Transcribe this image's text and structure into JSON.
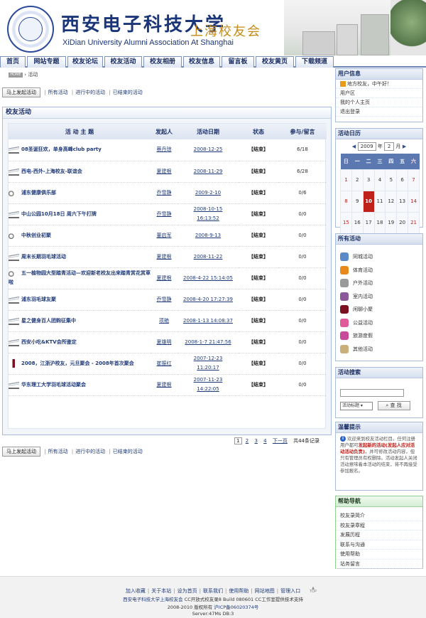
{
  "header": {
    "title": "西安电子科技大学",
    "subtitle": "上海校友会",
    "title_en": "XiDian University Alumni Association At Shanghai"
  },
  "nav": [
    {
      "label": "首页"
    },
    {
      "label": "网站专题"
    },
    {
      "label": "校友论坛"
    },
    {
      "label": "校友活动"
    },
    {
      "label": "校友相册"
    },
    {
      "label": "校友信息"
    },
    {
      "label": "留言板"
    },
    {
      "label": "校友黄页"
    },
    {
      "label": "下载频道"
    }
  ],
  "breadcrumb": {
    "home": "HOME",
    "current": "活动"
  },
  "actionbar": {
    "start": "马上发起活动",
    "all": "所有活动",
    "ongoing": "进行中的活动",
    "ended": "已结束的活动"
  },
  "main": {
    "title": "校友活动",
    "columns": [
      "活 动 主 题",
      "发起人",
      "活动日期",
      "状态",
      "参与/留言"
    ],
    "rows": [
      {
        "icon": "plane",
        "title": "08圣诞狂欢，单身高峰club party",
        "initiator": "蔡丹琼",
        "date": "2008-12-25",
        "time": "",
        "status": "【结束】",
        "count": "6/18"
      },
      {
        "icon": "plane",
        "title": "西电-西外-上海校友-联谊会",
        "initiator": "夏建根",
        "date": "2008-11-29",
        "time": "",
        "status": "【结束】",
        "count": "6/28"
      },
      {
        "icon": "bike",
        "title": "浦东健康俱乐部",
        "initiator": "乔雪静",
        "date": "2009-2-10",
        "time": "",
        "status": "【结束】",
        "count": "0/6"
      },
      {
        "icon": "plane",
        "title": "中山公园10月18日 周六下午打牌",
        "initiator": "乔雪静",
        "date": "2008-10-15",
        "time": "16:13:52",
        "status": "【结束】",
        "count": "0/0"
      },
      {
        "icon": "bike",
        "title": "中秋创业初聚",
        "initiator": "董启军",
        "date": "2008-9-13",
        "time": "",
        "status": "【结束】",
        "count": "0/0"
      },
      {
        "icon": "plane",
        "title": "周末长期羽毛球活动",
        "initiator": "夏建根",
        "date": "2008-11-22",
        "time": "",
        "status": "【结束】",
        "count": "0/0"
      },
      {
        "icon": "bike",
        "title": "五一植物园大型踏青活动—欢迎新老校友出来踏青赏花赏草啦",
        "initiator": "夏建根",
        "date": "2008-4-22 15:14:05",
        "time": "",
        "status": "【结束】",
        "count": "0/0"
      },
      {
        "icon": "plane",
        "title": "浦东羽毛球友聚",
        "initiator": "乔雪静",
        "date": "2008-4-20 17:27:39",
        "time": "",
        "status": "【结束】",
        "count": "0/0"
      },
      {
        "icon": "plane",
        "title": "星之健身百人团购征集中",
        "initiator": "项艳",
        "date": "2008-1-13 14:08:37",
        "time": "",
        "status": "【结束】",
        "count": "0/0"
      },
      {
        "icon": "plane",
        "title": "西安小吃&KTV会所鉴定",
        "initiator": "夏雄明",
        "date": "2008-1-7 21:47:56",
        "time": "",
        "status": "【结束】",
        "count": "0/0"
      },
      {
        "icon": "wine",
        "title": "2008，江浙沪校友，元旦聚会 - 2008年首次聚会",
        "initiator": "崔振红",
        "date": "2007-12-23",
        "time": "11:20:17",
        "status": "【结束】",
        "count": "0/0"
      },
      {
        "icon": "plane",
        "title": "华东理工大学羽毛球活动聚会",
        "initiator": "夏建根",
        "date": "2007-11-23",
        "time": "14:22:05",
        "status": "【结束】",
        "count": "0/0"
      }
    ],
    "pager": {
      "current": "1",
      "pages": [
        "2",
        "3",
        "4"
      ],
      "next": "下一页",
      "total": "共44条记录"
    }
  },
  "userinfo": {
    "title": "用户信息",
    "greeting": "地方校友，中午好！",
    "items": [
      "用户区",
      "我的个人主页",
      "退出登录"
    ]
  },
  "calendar": {
    "title": "活动日历",
    "year": "2009",
    "year_label": "年",
    "month": "2",
    "month_label": "月",
    "weekdays": [
      "日",
      "一",
      "二",
      "三",
      "四",
      "五",
      "六"
    ],
    "weeks": [
      [
        "1",
        "2",
        "3",
        "4",
        "5",
        "6",
        "7"
      ],
      [
        "8",
        "9",
        "10",
        "11",
        "12",
        "13",
        "14"
      ],
      [
        "15",
        "16",
        "17",
        "18",
        "19",
        "20",
        "21"
      ],
      [
        "22",
        "23",
        "24",
        "25",
        "26",
        "27",
        "28"
      ]
    ],
    "today": "10"
  },
  "allact": {
    "title": "所有活动",
    "items": [
      {
        "label": "同城活动",
        "color": "#5a8ac7"
      },
      {
        "label": "体育活动",
        "color": "#e88a1a"
      },
      {
        "label": "户外活动",
        "color": "#9a9a9a"
      },
      {
        "label": "室内活动",
        "color": "#8a5a9a"
      },
      {
        "label": "闲聊小聚",
        "color": "#7a1020"
      },
      {
        "label": "公益活动",
        "color": "#e05a9a"
      },
      {
        "label": "旅游度假",
        "color": "#c84a9a"
      },
      {
        "label": "其他活动",
        "color": "#c9b07a"
      }
    ]
  },
  "search": {
    "title": "活动搜索",
    "select": "活动标题",
    "button": "查 找"
  },
  "tips": {
    "title": "温馨提示",
    "text1": "欢迎来到校友活动栏目。任何注册用户都可",
    "red": "发起新的活动(发起人应对活动活动负责)",
    "text2": "，并可修改活动内容，但只有管理员有权删除。活动发起人关闭活动意味着本活动的结束，将不再接受参加报名。"
  },
  "helpnav": {
    "title": "帮助导航",
    "items": [
      "校友录简介",
      "校友录章程",
      "发展历程",
      "联系与沟通",
      "使用帮助",
      "站务留言"
    ]
  },
  "footer": {
    "links": [
      "加入收藏",
      "关于本站",
      "设为首页",
      "联系我们",
      "使用帮助",
      "网站地图",
      "管理入口"
    ],
    "org": "西安电子科技大学上海校友会",
    "powered": "CC开放式校友录8 Build 080601 CC工作室提供技术支持",
    "copy": "2008-2010 版权所有",
    "icp": "沪ICP备06020374号",
    "server": "Server:47Ms DB:3",
    "top": "TOP"
  }
}
